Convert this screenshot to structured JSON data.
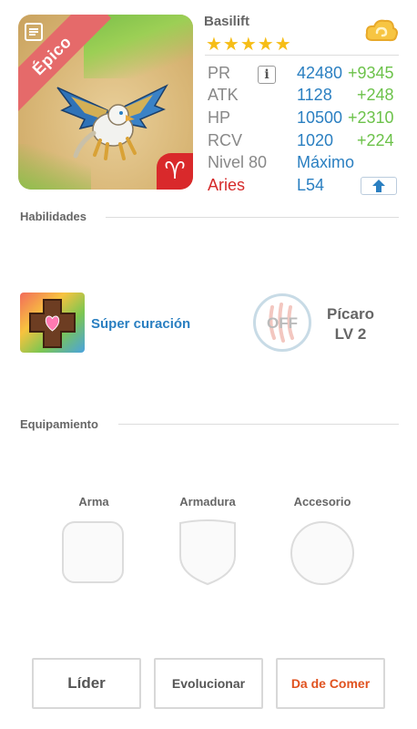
{
  "monster": {
    "rarity": "Épico",
    "name": "Basilift",
    "stars": "★★★★★",
    "zodiac_symbol": "♈"
  },
  "stats": {
    "pr": {
      "label": "PR",
      "value": "42480",
      "bonus": "+9345"
    },
    "atk": {
      "label": "ATK",
      "value": "1128",
      "bonus": "+248"
    },
    "hp": {
      "label": "HP",
      "value": "10500",
      "bonus": "+2310"
    },
    "rcv": {
      "label": "RCV",
      "value": "1020",
      "bonus": "+224"
    },
    "level": {
      "label": "Nivel 80",
      "value": "Máximo"
    },
    "sign": {
      "label": "Aries",
      "value": "L54"
    },
    "info_glyph": "i"
  },
  "skills": {
    "title": "Habilidades",
    "active_skill": "Súper curación",
    "leader_toggle": "OFF",
    "leader_name": "Pícaro",
    "leader_level": "LV 2"
  },
  "equipment": {
    "title": "Equipamiento",
    "slots": [
      {
        "label": "Arma"
      },
      {
        "label": "Armadura"
      },
      {
        "label": "Accesorio"
      }
    ]
  },
  "buttons": {
    "leader": "Líder",
    "evolve": "Evolucionar",
    "feed": "Da de Comer"
  },
  "colors": {
    "accent_blue": "#2a7fc1",
    "bonus_green": "#6cc24a",
    "rarity_red": "#e56a6a",
    "feed_orange": "#e0521f"
  }
}
